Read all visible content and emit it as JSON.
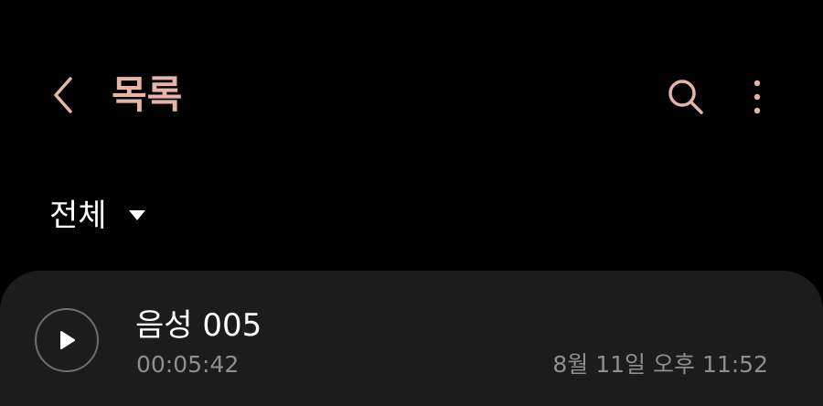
{
  "header": {
    "back_icon": "chevron-left-icon",
    "title": "목록",
    "search_icon": "search-icon",
    "more_icon": "more-vertical-icon",
    "accent_color": "#e6b5a8"
  },
  "filter": {
    "selected": "전체",
    "icon": "dropdown-triangle-icon"
  },
  "recordings": [
    {
      "title": "음성 005",
      "duration": "00:05:42",
      "date": "8월 11일 오후 11:52",
      "play_icon": "play-icon"
    }
  ]
}
